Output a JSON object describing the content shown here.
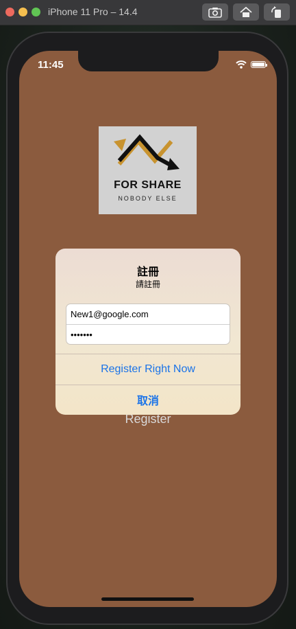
{
  "simulator": {
    "title": "iPhone 11 Pro – 14.4",
    "buttons": [
      "screenshot-icon",
      "home-icon",
      "rotate-icon"
    ]
  },
  "status_bar": {
    "time": "11:45",
    "icons": [
      "wifi-icon",
      "battery-icon"
    ]
  },
  "logo": {
    "title": "FOR SHARE",
    "subtitle": "NOBODY ELSE"
  },
  "background_button": {
    "label": "Register"
  },
  "alert": {
    "title": "註冊",
    "message": "請註冊",
    "email_value": "New1@google.com",
    "password_value": "1234567",
    "primary_button": "Register Right Now",
    "cancel_button": "取消"
  },
  "colors": {
    "screen_background": "#8b5b3e",
    "action_blue": "#1a73e8",
    "logo_accent": "#c8932f"
  }
}
